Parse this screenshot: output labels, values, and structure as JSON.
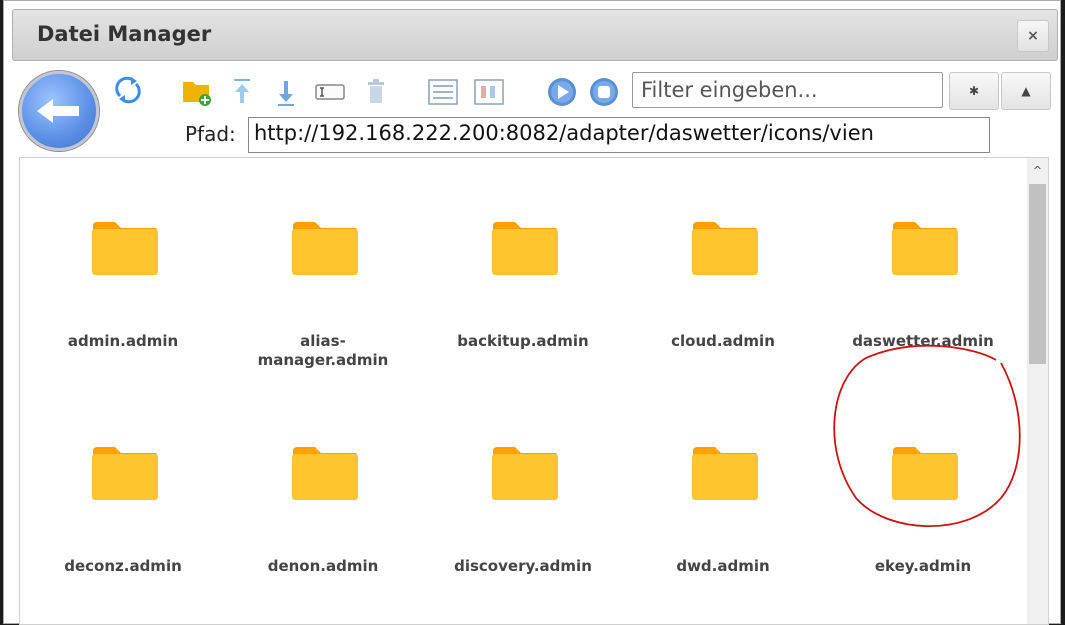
{
  "window": {
    "title": "Datei Manager",
    "close_label": "×"
  },
  "toolbar": {
    "icons": [
      "back-icon",
      "refresh-icon",
      "new-folder-icon",
      "upload-icon",
      "download-icon",
      "rename-icon",
      "delete-icon",
      "list-view-icon",
      "table-view-icon",
      "play-icon",
      "stop-icon"
    ],
    "filter_placeholder": "Filter eingeben...",
    "settings_label": "✱",
    "warning_label": "▲"
  },
  "path": {
    "label": "Pfad:",
    "value": "http://192.168.222.200:8082/adapter/daswetter/icons/vien"
  },
  "files": {
    "items": [
      {
        "name": "admin.admin"
      },
      {
        "name": "alias-\nmanager.admin"
      },
      {
        "name": "backitup.admin"
      },
      {
        "name": "cloud.admin"
      },
      {
        "name": "daswetter.admin"
      },
      {
        "name": "deconz.admin"
      },
      {
        "name": "denon.admin"
      },
      {
        "name": "discovery.admin"
      },
      {
        "name": "dwd.admin"
      },
      {
        "name": "ekey.admin"
      }
    ]
  },
  "colors": {
    "folder": "#FFC52C",
    "folder_tab": "#FFA000",
    "annotation": "#CC1111",
    "accent": "#4a84e0"
  }
}
